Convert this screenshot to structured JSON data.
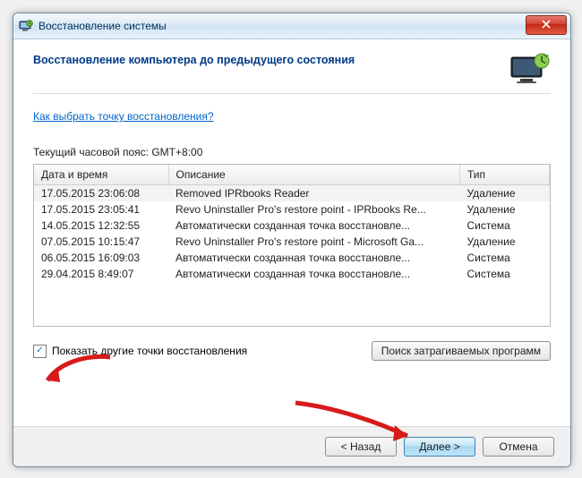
{
  "window": {
    "title": "Восстановление системы"
  },
  "header": {
    "title": "Восстановление компьютера до предыдущего состояния"
  },
  "link": {
    "howto": "Как выбрать точку восстановления?"
  },
  "tz": {
    "label": "Текущий часовой пояс: GMT+8:00"
  },
  "columns": {
    "datetime": "Дата и время",
    "description": "Описание",
    "type": "Тип"
  },
  "rows": [
    {
      "dt": "17.05.2015 23:06:08",
      "desc": "Removed IPRbooks Reader",
      "type": "Удаление"
    },
    {
      "dt": "17.05.2015 23:05:41",
      "desc": "Revo Uninstaller Pro's restore point - IPRbooks Re...",
      "type": "Удаление"
    },
    {
      "dt": "14.05.2015 12:32:55",
      "desc": "Автоматически созданная точка восстановле...",
      "type": "Система"
    },
    {
      "dt": "07.05.2015 10:15:47",
      "desc": "Revo Uninstaller Pro's restore point - Microsoft Ga...",
      "type": "Удаление"
    },
    {
      "dt": "06.05.2015 16:09:03",
      "desc": "Автоматически созданная точка восстановле...",
      "type": "Система"
    },
    {
      "dt": "29.04.2015 8:49:07",
      "desc": "Автоматически созданная точка восстановле...",
      "type": "Система"
    }
  ],
  "checkbox": {
    "show_other": "Показать другие точки восстановления",
    "checked": true
  },
  "buttons": {
    "affected": "Поиск затрагиваемых программ",
    "back": "< Назад",
    "next": "Далее >",
    "cancel": "Отмена"
  }
}
